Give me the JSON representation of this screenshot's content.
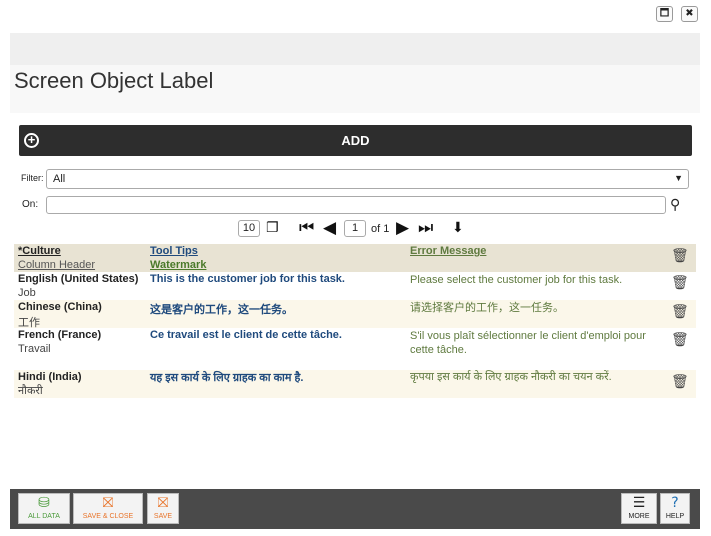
{
  "window": {
    "maximize_glyph": "🗖",
    "close_glyph": "✖"
  },
  "title": "Screen Object Label",
  "add_label": "ADD",
  "filter": {
    "label": "Filter:",
    "value": "All"
  },
  "on": {
    "label": "On:",
    "value": ""
  },
  "pager": {
    "page_size": "10",
    "page": "1",
    "of_label": "of 1"
  },
  "columns": {
    "culture": "*Culture",
    "column_header": "Column Header",
    "tool_tips": "Tool Tips",
    "watermark": "Watermark",
    "error_message": "Error Message"
  },
  "rows": [
    {
      "culture": "English (United States)",
      "header": "Job",
      "tooltip": "This is the customer job for this task.",
      "error": "Please select the customer job for this task."
    },
    {
      "culture": "Chinese (China)",
      "header": "工作",
      "tooltip": "这是客户的工作，这一任务。",
      "error": "请选择客户的工作，这一任务。"
    },
    {
      "culture": "French (France)",
      "header": "Travail",
      "tooltip": "Ce travail est le client de cette tâche.",
      "error": "S'il vous plaît sélectionner le client d'emploi pour cette tâche."
    },
    {
      "culture": "Hindi (India)",
      "header": "नौकरी",
      "tooltip": "यह इस कार्य के लिए ग्राहक का काम है.",
      "error": "कृपया इस कार्य के लिए ग्राहक नौकरी का चयन करें."
    }
  ],
  "footer": {
    "all_data": "ALL DATA",
    "save_close": "SAVE & CLOSE",
    "save": "SAVE",
    "more": "MORE",
    "help": "HELP"
  },
  "colors": {
    "accent_orange": "#e8742a",
    "accent_green": "#4a9a3a",
    "tooltip_blue": "#1f4a7d",
    "error_green": "#5f7a3f"
  }
}
